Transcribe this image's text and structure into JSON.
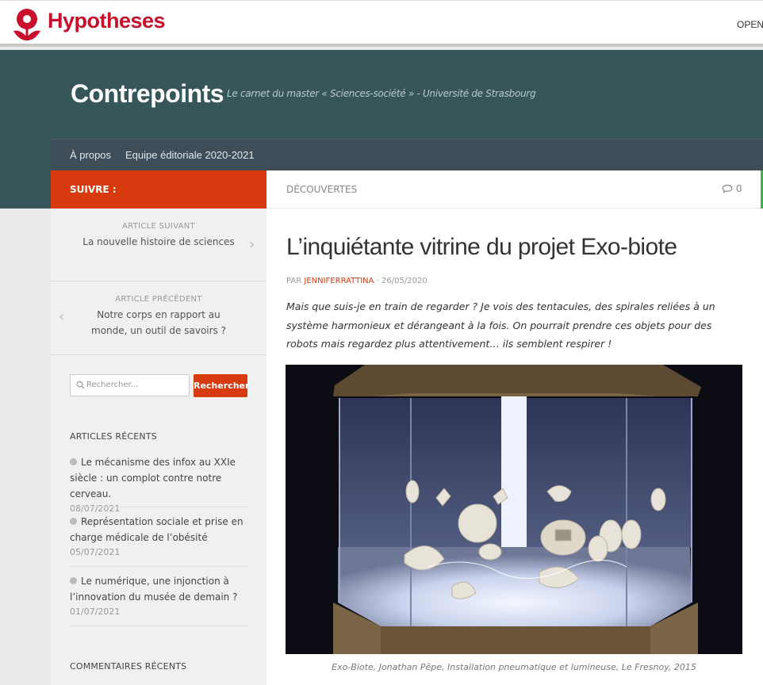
{
  "topbar": {
    "brand": "Hypotheses",
    "nav_item": "OPENI"
  },
  "site": {
    "title": "Contrepoints",
    "description": "Le carnet du master « Sciences-société » - Université de Strasbourg"
  },
  "nav": {
    "items": [
      {
        "label": "À propos"
      },
      {
        "label": "Equipe éditoriale 2020-2021"
      }
    ]
  },
  "sidebar": {
    "follow_label": "SUIVRE :",
    "next": {
      "label": "ARTICLE SUIVANT",
      "title": "La nouvelle histoire de sciences"
    },
    "prev": {
      "label": "ARTICLE PRÉCÉDENT",
      "title": "Notre corps en rapport au monde, un outil de savoirs ?"
    },
    "search": {
      "placeholder": "Rechercher...",
      "button": "Rechercher"
    },
    "recent_title": "ARTICLES RÉCENTS",
    "recent": [
      {
        "title": "Le mécanisme des infox au XXIe siècle : un complot contre notre cerveau.",
        "date": "08/07/2021"
      },
      {
        "title": "Représentation sociale et prise en charge médicale de l’obésité",
        "date": "05/07/2021"
      },
      {
        "title": "Le numérique, une injonction à l’innovation du musée de demain ?",
        "date": "01/07/2021"
      }
    ],
    "comments_title": "COMMENTAIRES RÉCENTS"
  },
  "post": {
    "category": "DÉCOUVERTES",
    "comment_count": "0",
    "title": "L’inquiétante vitrine du projet Exo-biote",
    "by": "PAR",
    "author": "JENNIFERRATTINA",
    "date": "· 26/05/2020",
    "excerpt": "Mais que suis-je en train de regarder ? Je vois des tentacules, des spirales reliées à un système harmonieux et dérangeant à la fois. On pourrait prendre ces objets pour des robots mais regardez plus attentivement… ils semblent respirer !",
    "caption": "Exo-Biote, Jonathan Pêpe, Installation pneumatique et lumineuse, Le Fresnoy, 2015"
  },
  "colors": {
    "brand_red": "#c8102e",
    "accent": "#d73a0f",
    "header_bg": "#36565a",
    "nav_bg": "#3f4d58"
  }
}
